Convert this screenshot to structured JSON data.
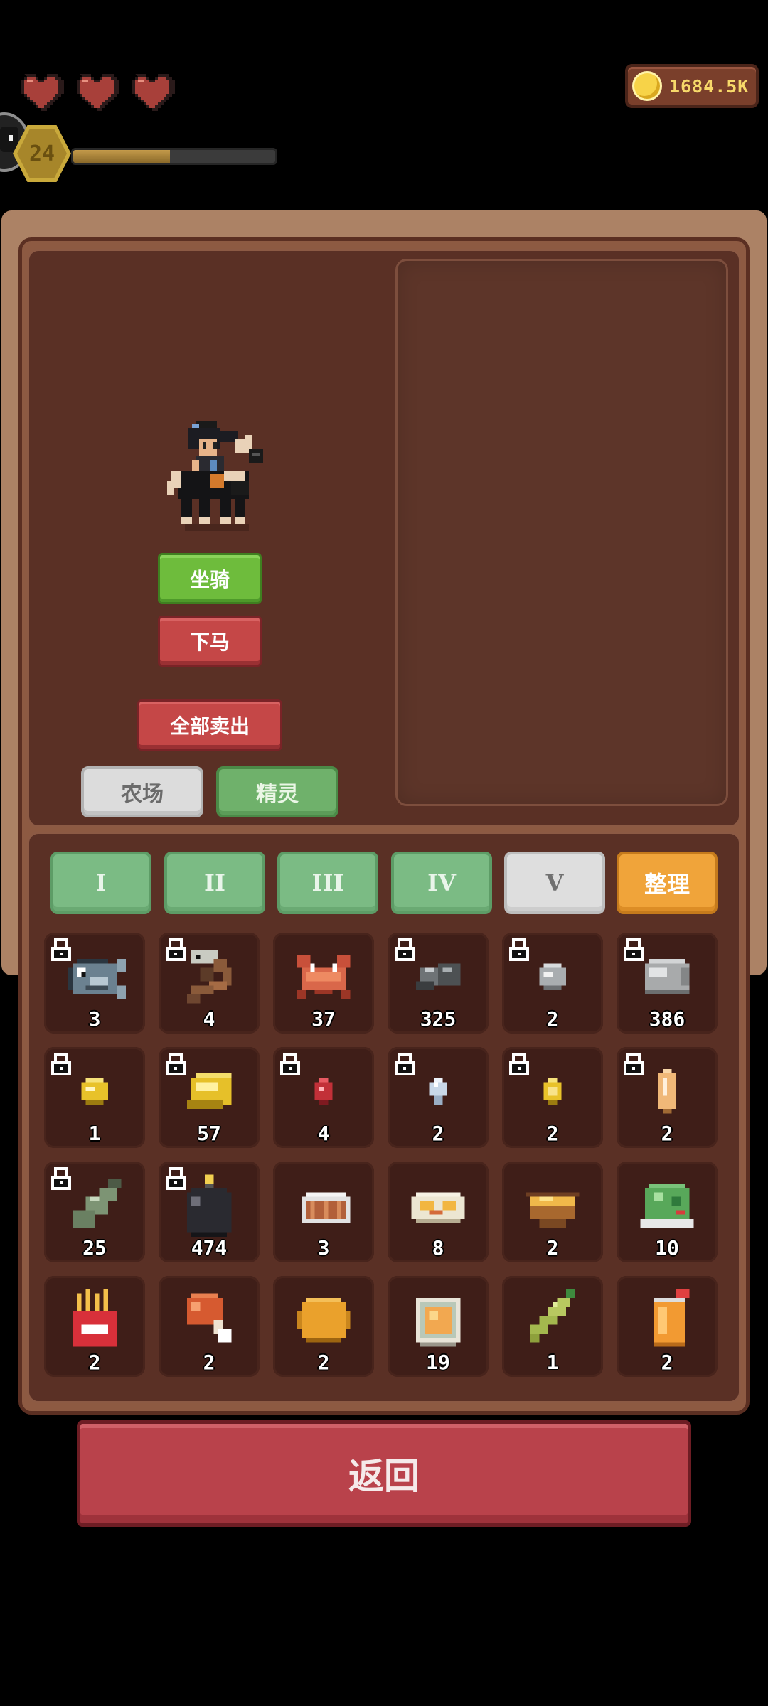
{
  "hud": {
    "hearts": 3,
    "coins": "1684.5K",
    "level": "24",
    "xp_fraction": 0.48
  },
  "buttons": {
    "mount": "坐骑",
    "dismount": "下马",
    "sell_all": "全部卖出",
    "farm": "农场",
    "spirit": "精灵",
    "back": "返回"
  },
  "tabs": [
    "I",
    "II",
    "III",
    "IV",
    "V"
  ],
  "active_tab": "V",
  "sort_label": "整理",
  "colors": {
    "green_button": "#6ebc3c",
    "red_button": "#c54747",
    "sort_button": "#f0a43a",
    "panel": "#5a3025",
    "slot": "#3f1e18"
  },
  "inventory": [
    {
      "icon": "fish-icon",
      "count": "3",
      "locked": true
    },
    {
      "icon": "eel-icon",
      "count": "4",
      "locked": true
    },
    {
      "icon": "crab-icon",
      "count": "37",
      "locked": false
    },
    {
      "icon": "iron-ore-icon",
      "count": "325",
      "locked": true
    },
    {
      "icon": "silver-nugget-icon",
      "count": "2",
      "locked": true
    },
    {
      "icon": "stone-icon",
      "count": "386",
      "locked": true
    },
    {
      "icon": "gold-nugget-icon",
      "count": "1",
      "locked": true
    },
    {
      "icon": "gold-bar-icon",
      "count": "57",
      "locked": true
    },
    {
      "icon": "ruby-icon",
      "count": "4",
      "locked": true
    },
    {
      "icon": "diamond-icon",
      "count": "2",
      "locked": true
    },
    {
      "icon": "gold-coin-icon",
      "count": "2",
      "locked": true
    },
    {
      "icon": "amber-icon",
      "count": "2",
      "locked": true
    },
    {
      "icon": "bottle-icon",
      "count": "25",
      "locked": true
    },
    {
      "icon": "bomb-icon",
      "count": "474",
      "locked": true
    },
    {
      "icon": "grilled-fish-icon",
      "count": "3",
      "locked": false
    },
    {
      "icon": "omelette-icon",
      "count": "8",
      "locked": false
    },
    {
      "icon": "soup-bowl-icon",
      "count": "2",
      "locked": false
    },
    {
      "icon": "salad-icon",
      "count": "10",
      "locked": false
    },
    {
      "icon": "fries-icon",
      "count": "2",
      "locked": false
    },
    {
      "icon": "drumstick-icon",
      "count": "2",
      "locked": false
    },
    {
      "icon": "pie-icon",
      "count": "2",
      "locked": false
    },
    {
      "icon": "ramen-bowl-icon",
      "count": "19",
      "locked": false
    },
    {
      "icon": "grapes-icon",
      "count": "1",
      "locked": false
    },
    {
      "icon": "juice-icon",
      "count": "2",
      "locked": false
    }
  ]
}
